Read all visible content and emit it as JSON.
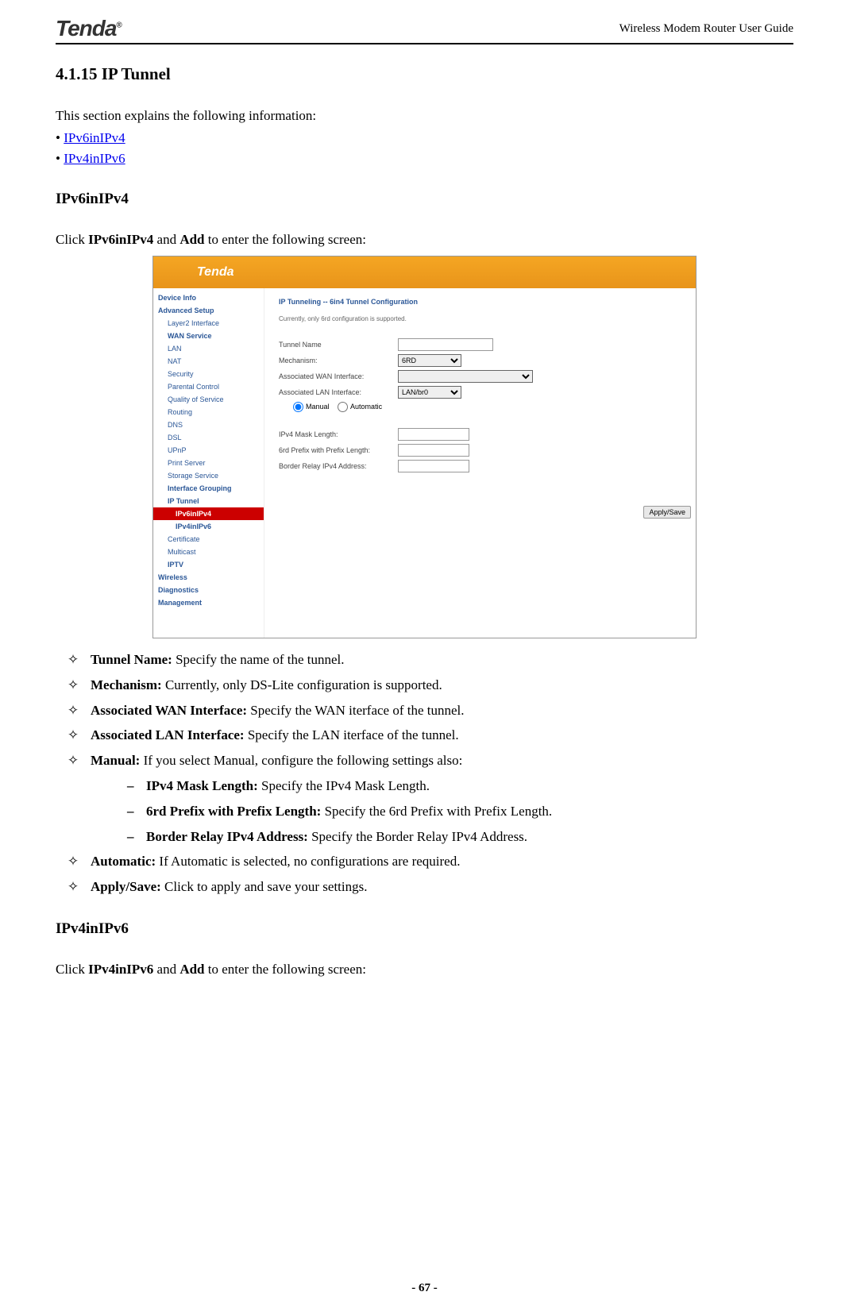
{
  "header": {
    "logo": "Tenda",
    "docTitle": "Wireless Modem Router User Guide"
  },
  "section": {
    "number": "4.1.15",
    "title": "IP Tunnel"
  },
  "intro": {
    "text": "This section explains the following information:",
    "links": [
      "IPv6inIPv4",
      "IPv4inIPv6"
    ]
  },
  "ipv6in4": {
    "heading": "IPv6inIPv4",
    "clickTextPre": "Click ",
    "clickBold1": "IPv6inIPv4",
    "clickMid": " and ",
    "clickBold2": "Add",
    "clickPost": " to enter the following screen:"
  },
  "screenshot": {
    "logo": "Tenda",
    "nav": {
      "deviceInfo": "Device Info",
      "advancedSetup": "Advanced Setup",
      "layer2": "Layer2 Interface",
      "wanService": "WAN Service",
      "lan": "LAN",
      "nat": "NAT",
      "security": "Security",
      "parental": "Parental Control",
      "qos": "Quality of Service",
      "routing": "Routing",
      "dns": "DNS",
      "dsl": "DSL",
      "upnp": "UPnP",
      "printServer": "Print Server",
      "storage": "Storage Service",
      "ifaceGroup": "Interface Grouping",
      "ipTunnel": "IP Tunnel",
      "ipv6inipv4": "IPv6inIPv4",
      "ipv4inipv6": "IPv4inIPv6",
      "certificate": "Certificate",
      "multicast": "Multicast",
      "iptv": "IPTV",
      "wireless": "Wireless",
      "diagnostics": "Diagnostics",
      "management": "Management"
    },
    "content": {
      "title": "IP Tunneling -- 6in4 Tunnel Configuration",
      "note": "Currently, only 6rd configuration is supported.",
      "tunnelName": "Tunnel Name",
      "mechanism": "Mechanism:",
      "mechanismVal": "6RD",
      "assocWan": "Associated WAN Interface:",
      "assocLan": "Associated LAN Interface:",
      "assocLanVal": "LAN/br0",
      "manual": "Manual",
      "automatic": "Automatic",
      "ipv4Mask": "IPv4 Mask Length:",
      "prefix6rd": "6rd Prefix with Prefix Length:",
      "borderRelay": "Border Relay IPv4 Address:",
      "applySave": "Apply/Save"
    }
  },
  "bullets": [
    {
      "bold": "Tunnel Name:",
      "text": " Specify the name of the tunnel."
    },
    {
      "bold": "Mechanism:",
      "text": " Currently, only DS-Lite configuration is supported."
    },
    {
      "bold": "Associated WAN Interface:",
      "text": " Specify the WAN iterface of the tunnel."
    },
    {
      "bold": "Associated LAN Interface:",
      "text": " Specify the LAN iterface of the tunnel."
    },
    {
      "bold": "Manual:",
      "text": " If you select Manual, configure the following settings also:"
    }
  ],
  "subBullets": [
    {
      "bold": "IPv4 Mask Length:",
      "text": " Specify the IPv4 Mask Length."
    },
    {
      "bold": "6rd Prefix with Prefix Length:",
      "text": " Specify the 6rd Prefix with Prefix Length."
    },
    {
      "bold": "Border Relay IPv4 Address:",
      "text": " Specify the Border Relay IPv4 Address."
    }
  ],
  "bullets2": [
    {
      "bold": "Automatic:",
      "text": " If Automatic is selected, no configurations are required."
    },
    {
      "bold": "Apply/Save:",
      "text": " Click to apply and save your settings."
    }
  ],
  "ipv4in6": {
    "heading": "IPv4inIPv6",
    "clickTextPre": "Click ",
    "clickBold1": "IPv4inIPv6",
    "clickMid": " and ",
    "clickBold2": "Add",
    "clickPost": " to enter the following screen:"
  },
  "footer": {
    "page": "- 67 -"
  }
}
